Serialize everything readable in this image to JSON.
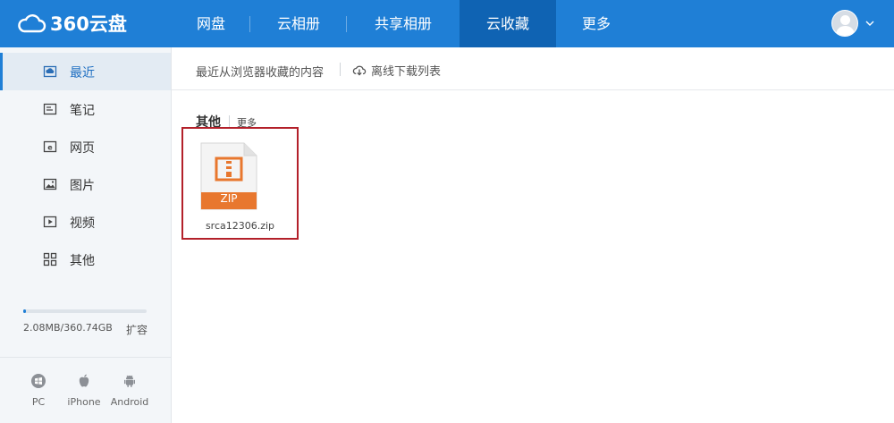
{
  "header": {
    "logo_text": "360云盘",
    "nav": [
      {
        "label": "网盘"
      },
      {
        "label": "云相册"
      },
      {
        "label": "共享相册"
      },
      {
        "label": "云收藏"
      },
      {
        "label": "更多"
      }
    ],
    "active_nav": "云收藏"
  },
  "sidebar": {
    "items": [
      {
        "label": "最近",
        "icon": "recent-icon"
      },
      {
        "label": "笔记",
        "icon": "note-icon"
      },
      {
        "label": "网页",
        "icon": "webpage-icon"
      },
      {
        "label": "图片",
        "icon": "image-icon"
      },
      {
        "label": "视频",
        "icon": "video-icon"
      },
      {
        "label": "其他",
        "icon": "grid-icon"
      }
    ],
    "active_item": "最近",
    "quota": {
      "text": "2.08MB/360.74GB",
      "used_fraction": 0.02,
      "expand_label": "扩容"
    },
    "clients": [
      {
        "label": "PC",
        "icon": "windows-icon"
      },
      {
        "label": "iPhone",
        "icon": "apple-icon"
      },
      {
        "label": "Android",
        "icon": "android-icon"
      }
    ]
  },
  "main": {
    "toolbar": {
      "description": "最近从浏览器收藏的内容",
      "offline_download_label": "离线下载列表"
    },
    "section": {
      "title": "其他",
      "more_label": "更多"
    },
    "files": [
      {
        "name": "srca12306.zip",
        "type_label": "ZIP"
      }
    ]
  },
  "colors": {
    "header_bg": "#1f7fd6",
    "header_active": "#0f63b3",
    "zip_orange": "#e8772e",
    "highlight_border": "#b3202a"
  }
}
